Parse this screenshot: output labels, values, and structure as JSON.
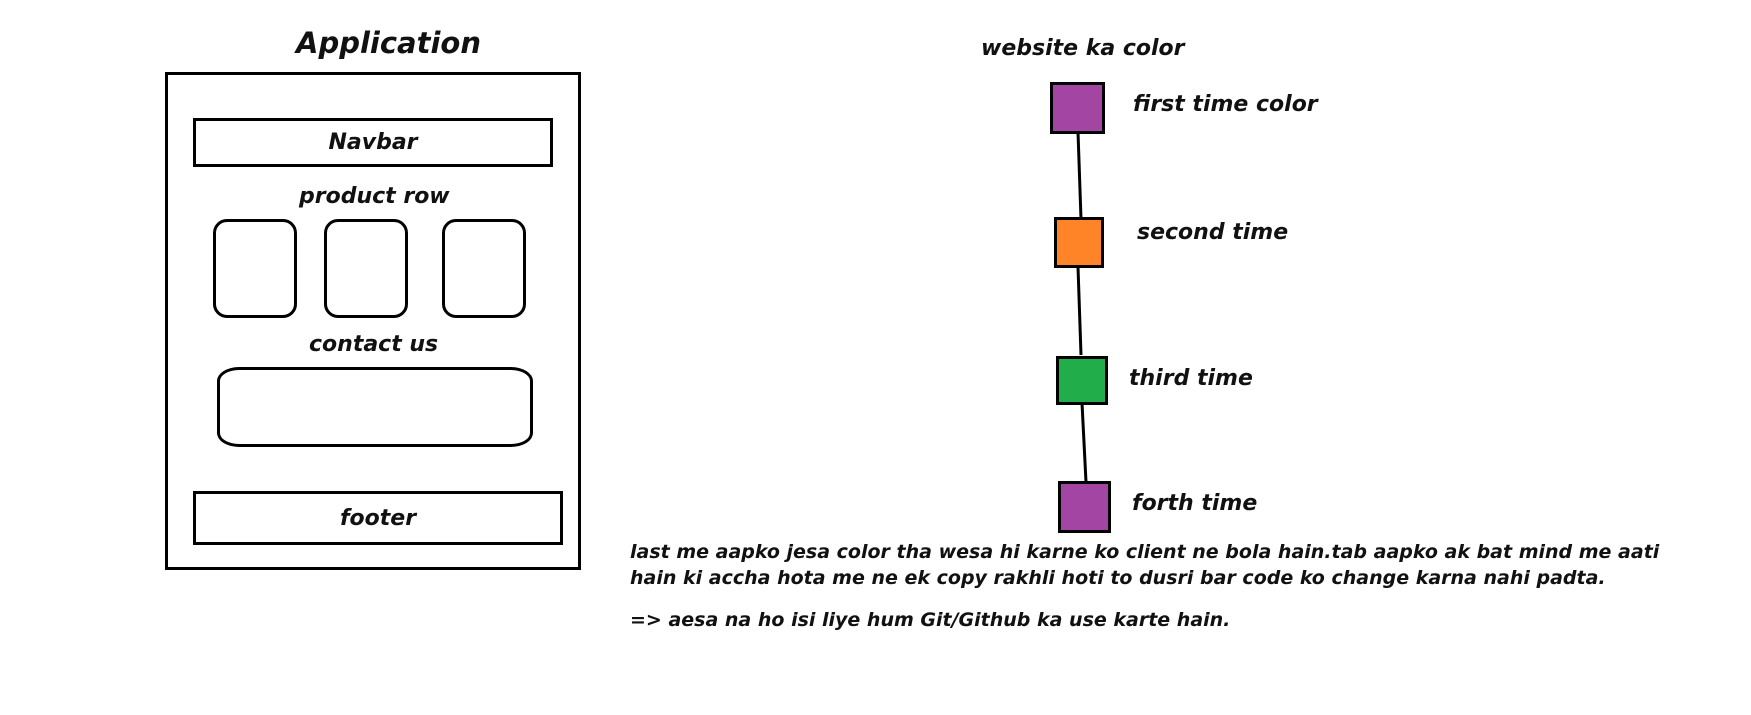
{
  "app_diagram": {
    "title": "Application",
    "navbar": "Navbar",
    "product_row": "product row",
    "contact_us": "contact us",
    "footer": "footer"
  },
  "timeline": {
    "title": "website ka color",
    "steps": [
      {
        "label": "first time color",
        "color": "#A346A3"
      },
      {
        "label": "second time",
        "color": "#FF8428"
      },
      {
        "label": "third time",
        "color": "#21AE4A"
      },
      {
        "label": "forth time",
        "color": "#A346A3"
      }
    ]
  },
  "notes": {
    "line1": "last me aapko jesa color tha wesa hi karne ko client ne bola hain.tab aapko ak bat mind me aati",
    "line2": "hain ki accha hota me ne ek copy rakhli hoti to dusri bar code ko change karna nahi padta.",
    "line3": "=> aesa na ho isi liye hum Git/Github ka use karte hain."
  }
}
